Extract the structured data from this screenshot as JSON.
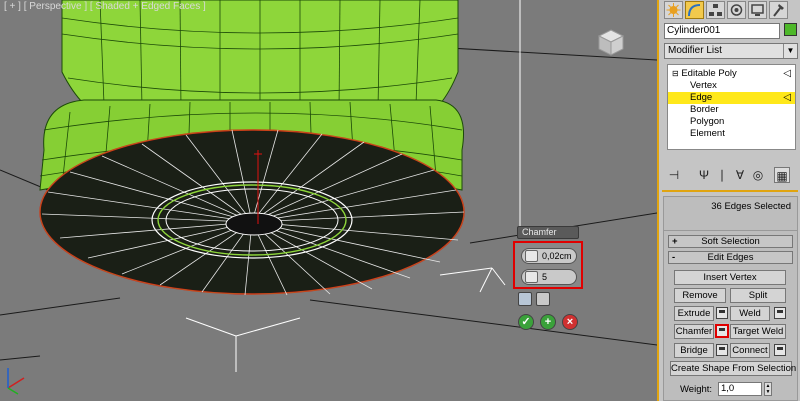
{
  "viewport": {
    "label": "[ + ] [ Perspective ] [ Shaded + Edged Faces ]",
    "caddy": {
      "title": "Chamfer",
      "amount": "0,02cm",
      "segments": "5"
    }
  },
  "panel": {
    "tabs": [
      "create-icon",
      "modify-icon",
      "hierarchy-icon",
      "motion-icon",
      "display-icon",
      "utilities-icon"
    ],
    "object_name": "Cylinder001",
    "object_color": "#4eb82a",
    "modifier_list": "Modifier List",
    "stack": {
      "root": "Editable Poly",
      "subobjects": [
        "Vertex",
        "Edge",
        "Border",
        "Polygon",
        "Element"
      ],
      "selected": "Edge"
    },
    "selection_info": "36 Edges Selected",
    "rollouts": {
      "soft_selection": {
        "sign": "+",
        "title": "Soft Selection"
      },
      "edit_edges": {
        "sign": "-",
        "title": "Edit Edges"
      }
    },
    "buttons": {
      "insert_vertex": "Insert Vertex",
      "remove": "Remove",
      "split": "Split",
      "extrude": "Extrude",
      "weld": "Weld",
      "chamfer": "Chamfer",
      "target_weld": "Target Weld",
      "bridge": "Bridge",
      "connect": "Connect",
      "create_shape": "Create Shape From Selection"
    },
    "weight_label": "Weight:",
    "weight_value": "1,0"
  },
  "colors": {
    "accent": "#e0a410",
    "selection_highlight": "#ffe81a",
    "callout_red": "#e00000",
    "mesh_green": "#8ed63a"
  }
}
